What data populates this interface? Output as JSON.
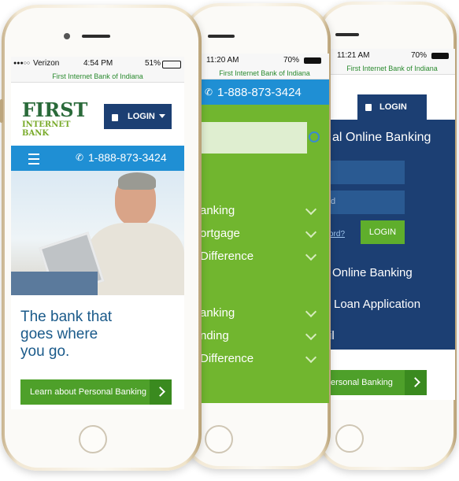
{
  "phone3": {
    "status": {
      "time": "11:21 AM",
      "battery": "70%"
    },
    "url": "First Internet Bank of Indiana",
    "login_label": "LOGIN",
    "online_banking_heading": "al Online Banking",
    "field2_partial": "d",
    "forgot_partial": "ord?",
    "login_button": "LOGIN",
    "links": [
      "Online Banking",
      "Loan Application",
      "il"
    ],
    "cta_partial": "ersonal Banking"
  },
  "phone2": {
    "status": {
      "time": "11:20 AM",
      "battery": "70%"
    },
    "url": "First Internet Bank of Indiana",
    "phone_number": "1-888-873-3424",
    "menu_group1": [
      "anking",
      "ortgage",
      "Difference"
    ],
    "menu_group2": [
      "anking",
      "nding",
      "Difference"
    ]
  },
  "phone1": {
    "status": {
      "carrier": "Verizon",
      "time": "4:54 PM",
      "battery": "51%"
    },
    "url": "First Internet Bank of Indiana",
    "logo": {
      "first": "FIRST",
      "internet_bank": "INTERNET BANK"
    },
    "login_label": "LOGIN",
    "phone_number": "1-888-873-3424",
    "hero_headline": "The bank that goes where you go.",
    "cta": "Learn about Personal Banking"
  },
  "colors": {
    "accent_blue": "#1f8fd4",
    "navy": "#1c3f73",
    "green": "#71b62f",
    "brand_green": "#4ea02a"
  }
}
